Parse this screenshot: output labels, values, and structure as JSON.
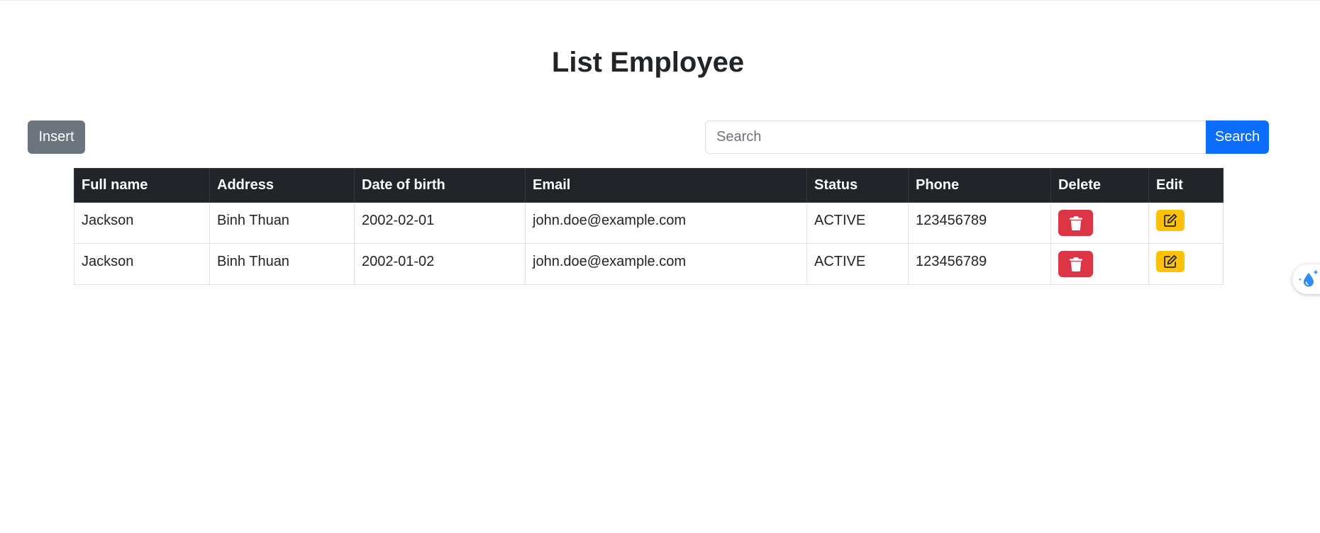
{
  "page": {
    "title": "List Employee"
  },
  "toolbar": {
    "insert_label": "Insert",
    "search_placeholder": "Search",
    "search_value": "",
    "search_button_label": "Search"
  },
  "table": {
    "columns": [
      "Full name",
      "Address",
      "Date of birth",
      "Email",
      "Status",
      "Phone",
      "Delete",
      "Edit"
    ],
    "rows": [
      {
        "full_name": "Jackson",
        "address": "Binh Thuan",
        "dob": "2002-02-01",
        "email": "john.doe@example.com",
        "status": "ACTIVE",
        "phone": "123456789"
      },
      {
        "full_name": "Jackson",
        "address": "Binh Thuan",
        "dob": "2002-01-02",
        "email": "john.doe@example.com",
        "status": "ACTIVE",
        "phone": "123456789"
      }
    ]
  },
  "icons": {
    "delete": "trash-icon",
    "edit": "pencil-square-icon",
    "widget": "water-drop-sparkle-icon"
  },
  "colors": {
    "insert_button": "#6c757d",
    "search_button": "#0d6efd",
    "header_bg": "#212529",
    "delete_button": "#dc3545",
    "edit_button": "#ffc107",
    "widget_accent": "#2f8cf0"
  }
}
